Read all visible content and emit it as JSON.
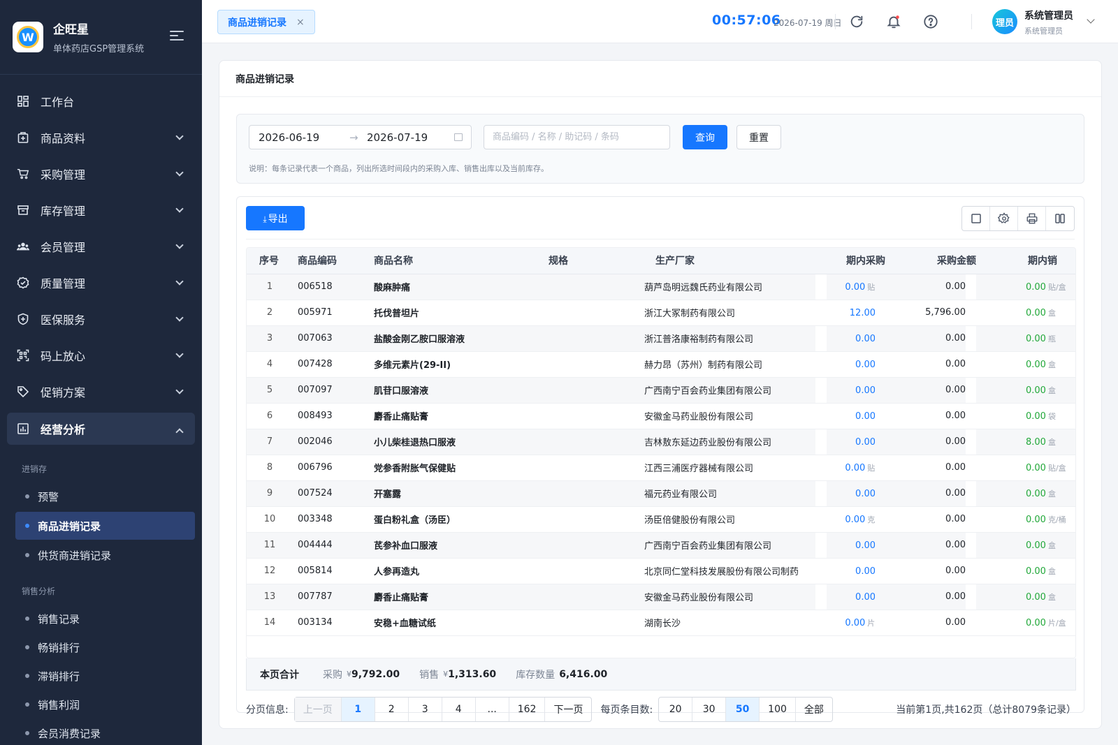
{
  "app": {
    "name": "企旺星",
    "subtitle": "单体药店GSP管理系统"
  },
  "sidebar": {
    "menu": [
      {
        "label": "工作台",
        "icon": "dashboard-icon",
        "has_children": false
      },
      {
        "label": "商品资料",
        "icon": "product-icon",
        "has_children": true
      },
      {
        "label": "采购管理",
        "icon": "cart-icon",
        "has_children": true
      },
      {
        "label": "库存管理",
        "icon": "inventory-icon",
        "has_children": true
      },
      {
        "label": "会员管理",
        "icon": "members-icon",
        "has_children": true
      },
      {
        "label": "质量管理",
        "icon": "quality-badge-icon",
        "has_children": true
      },
      {
        "label": "医保服务",
        "icon": "shield-plus-icon",
        "has_children": true
      },
      {
        "label": "码上放心",
        "icon": "qrcode-icon",
        "has_children": true
      },
      {
        "label": "促销方案",
        "icon": "tag-icon",
        "has_children": true
      }
    ],
    "open_menu": {
      "label": "经营分析",
      "icon": "bar-chart-icon"
    },
    "groups": [
      {
        "title": "进销存",
        "items": [
          {
            "label": "预警",
            "active": false
          },
          {
            "label": "商品进销记录",
            "active": true
          },
          {
            "label": "供货商进销记录",
            "active": false
          }
        ]
      },
      {
        "title": "销售分析",
        "items": [
          {
            "label": "销售记录",
            "active": false
          },
          {
            "label": "畅销排行",
            "active": false
          },
          {
            "label": "滞销排行",
            "active": false
          },
          {
            "label": "销售利润",
            "active": false
          },
          {
            "label": "会员消费记录",
            "active": false
          }
        ]
      }
    ]
  },
  "topbar": {
    "tab_label": "商品进销记录",
    "tab_close": "×",
    "clock": "00:57:06",
    "date": "2026-07-19 周日",
    "avatar_text": "理员",
    "user_name": "系统管理员",
    "user_role": "系统管理员"
  },
  "page": {
    "title": "商品进销记录",
    "search": {
      "start_date": "2026-06-19",
      "arrow": "→",
      "end_date": "2026-07-19",
      "keyword_placeholder": "商品编码 / 名称 / 助记码 / 条码",
      "query_label": "查询",
      "reset_label": "重置",
      "note": "说明：每条记录代表一个商品，列出所选时间段内的采购入库、销售出库以及当前库存。"
    },
    "export_label": "导出",
    "columns": [
      "序号",
      "商品编码",
      "商品名称",
      "规格",
      "生产厂家",
      "期内采购",
      "采购金额",
      "期内销"
    ],
    "rows": [
      {
        "idx": "1",
        "code": "006518",
        "name": "酸麻肿痛",
        "spec": "",
        "maker": "葫芦岛明远魏氏药业有限公司",
        "purchase": "0.00",
        "p_unit": "贴/盒",
        "amount": "0.00",
        "sales": "0.00",
        "s_unit": "贴/盒"
      },
      {
        "idx": "2",
        "code": "005971",
        "name": "托伐普坦片",
        "spec": "",
        "maker": "浙江大冢制药有限公司",
        "purchase": "12.00",
        "p_unit": "盒",
        "amount": "5,796.00",
        "sales": "0.00",
        "s_unit": "盒"
      },
      {
        "idx": "3",
        "code": "007063",
        "name": "盐酸金刚乙胺口服溶液",
        "spec": "",
        "maker": "浙江普洛康裕制药有限公司",
        "purchase": "0.00",
        "p_unit": "瓶",
        "amount": "0.00",
        "sales": "0.00",
        "s_unit": "瓶"
      },
      {
        "idx": "4",
        "code": "007428",
        "name": "多维元素片(29-II)",
        "spec": "",
        "maker": "赫力昂（苏州）制药有限公司",
        "purchase": "0.00",
        "p_unit": "盒",
        "amount": "0.00",
        "sales": "0.00",
        "s_unit": "盒"
      },
      {
        "idx": "5",
        "code": "007097",
        "name": "肌苷口服溶液",
        "spec": "",
        "maker": "广西南宁百会药业集团有限公司",
        "purchase": "0.00",
        "p_unit": "盒",
        "amount": "0.00",
        "sales": "0.00",
        "s_unit": "盒"
      },
      {
        "idx": "6",
        "code": "008493",
        "name": "麝香止痛贴膏",
        "spec": "",
        "maker": "安徽金马药业股份有限公司",
        "purchase": "0.00",
        "p_unit": "袋",
        "amount": "0.00",
        "sales": "0.00",
        "s_unit": "袋"
      },
      {
        "idx": "7",
        "code": "002046",
        "name": "小儿柴桂退热口服液",
        "spec": "",
        "maker": "吉林敖东延边药业股份有限公司",
        "purchase": "0.00",
        "p_unit": "盒",
        "amount": "0.00",
        "sales": "8.00",
        "s_unit": "盒"
      },
      {
        "idx": "8",
        "code": "006796",
        "name": "党参香附胀气保健贴",
        "spec": "",
        "maker": "江西三浦医疗器械有限公司",
        "purchase": "0.00",
        "p_unit": "贴/盒",
        "amount": "0.00",
        "sales": "0.00",
        "s_unit": "贴/盒"
      },
      {
        "idx": "9",
        "code": "007524",
        "name": "开塞露",
        "spec": "",
        "maker": "福元药业有限公司",
        "purchase": "0.00",
        "p_unit": "盒",
        "amount": "0.00",
        "sales": "0.00",
        "s_unit": "盒"
      },
      {
        "idx": "10",
        "code": "003348",
        "name": "蛋白粉礼盒（汤臣）",
        "spec": "",
        "maker": "汤臣倍健股份有限公司",
        "purchase": "0.00",
        "p_unit": "克/桶",
        "amount": "0.00",
        "sales": "0.00",
        "s_unit": "克/桶"
      },
      {
        "idx": "11",
        "code": "004444",
        "name": "芪参补血口服液",
        "spec": "",
        "maker": "广西南宁百会药业集团有限公司",
        "purchase": "0.00",
        "p_unit": "盒",
        "amount": "0.00",
        "sales": "0.00",
        "s_unit": "盒"
      },
      {
        "idx": "12",
        "code": "005814",
        "name": "人参再造丸",
        "spec": "",
        "maker": "北京同仁堂科技发展股份有限公司制药厂",
        "purchase": "0.00",
        "p_unit": "盒",
        "amount": "0.00",
        "sales": "0.00",
        "s_unit": "盒"
      },
      {
        "idx": "13",
        "code": "007787",
        "name": "麝香止痛贴膏",
        "spec": "",
        "maker": "安徽金马药业股份有限公司",
        "purchase": "0.00",
        "p_unit": "盒",
        "amount": "0.00",
        "sales": "0.00",
        "s_unit": "盒"
      },
      {
        "idx": "14",
        "code": "003134",
        "name": "安稳+血糖试纸",
        "spec": "",
        "maker": "湖南长沙",
        "purchase": "0.00",
        "p_unit": "片/盒",
        "amount": "0.00",
        "sales": "0.00",
        "s_unit": "片/盒"
      }
    ],
    "summary": {
      "title": "本页合计",
      "purchase_label": "采购",
      "purchase_value": "9,792.00",
      "sales_label": "销售",
      "sales_value": "1,313.60",
      "stock_label": "库存数量",
      "stock_value": "6,416.00",
      "currency": "¥"
    },
    "pager": {
      "label": "分页信息:",
      "prev": "上一页",
      "pages": [
        "1",
        "2",
        "3",
        "4",
        "...",
        "162"
      ],
      "current": "1",
      "next": "下一页",
      "size_label": "每页条目数:",
      "sizes": [
        "20",
        "30",
        "50",
        "100",
        "全部"
      ],
      "current_size": "50",
      "info": "当前第1页,共162页（总计8079条记录）"
    }
  },
  "colors": {
    "accent": "#1677ff",
    "sidebar_bg": "#1e283c",
    "sales_green": "#22a83a"
  }
}
